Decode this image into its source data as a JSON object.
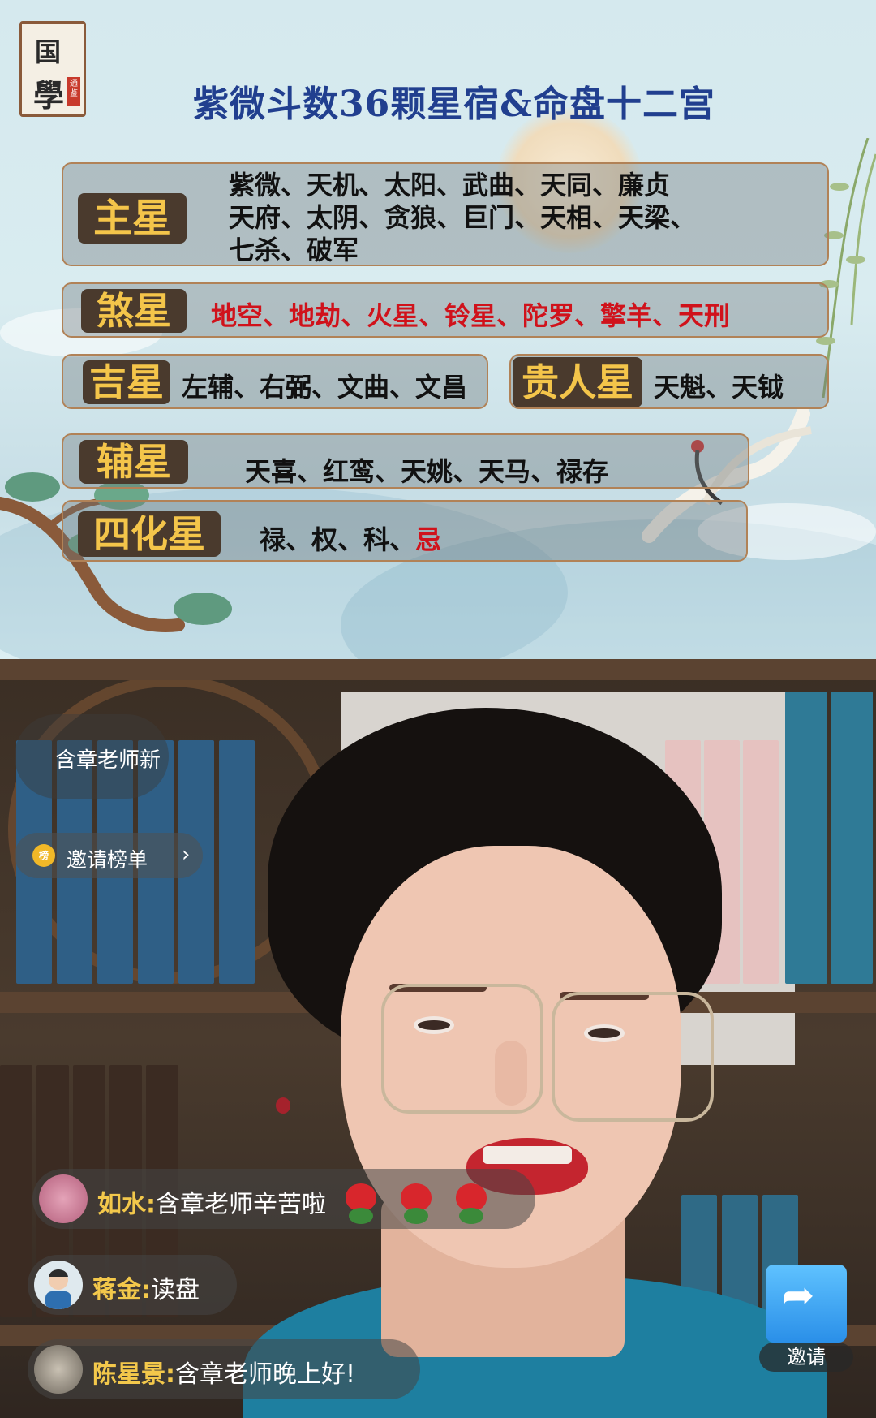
{
  "slide": {
    "logo_char_top": "国",
    "logo_char_bottom": "學",
    "logo_seal": "通鉴",
    "title": "紫微斗数36颗星宿&命盘十二宫",
    "groups": {
      "main": {
        "tag": "主星",
        "line1": "紫微、天机、太阳、武曲、天同、廉贞",
        "line2": "天府、太阴、贪狼、巨门、天相、天梁、",
        "line3": "七杀、破军"
      },
      "sha": {
        "tag": "煞星",
        "items": "地空、地劫、火星、铃星、陀罗、擎羊、天刑"
      },
      "ji": {
        "tag": "吉星",
        "items": "左辅、右弼、文曲、文昌"
      },
      "guiren": {
        "tag": "贵人星",
        "items": "天魁、天钺"
      },
      "fu": {
        "tag": "辅星",
        "items": "天喜、红鸾、天姚、天马、禄存"
      },
      "sihua": {
        "tag": "四化星",
        "items_black": "禄、权、科、",
        "items_red": "忌"
      }
    },
    "colors": {
      "title": "#213f8f",
      "tag_text": "#f4c54a",
      "red_items": "#d0121b"
    }
  },
  "live": {
    "host_name": "含章老师新",
    "invite_rank_label": "邀请榜单",
    "medal_text": "榜",
    "comments": [
      {
        "name": "如水:",
        "message": "含章老师辛苦啦"
      },
      {
        "name": "蒋金:",
        "message": "读盘"
      },
      {
        "name": "陈星景:",
        "message": "含章老师晚上好!"
      }
    ],
    "invite_button_label": "邀请"
  }
}
